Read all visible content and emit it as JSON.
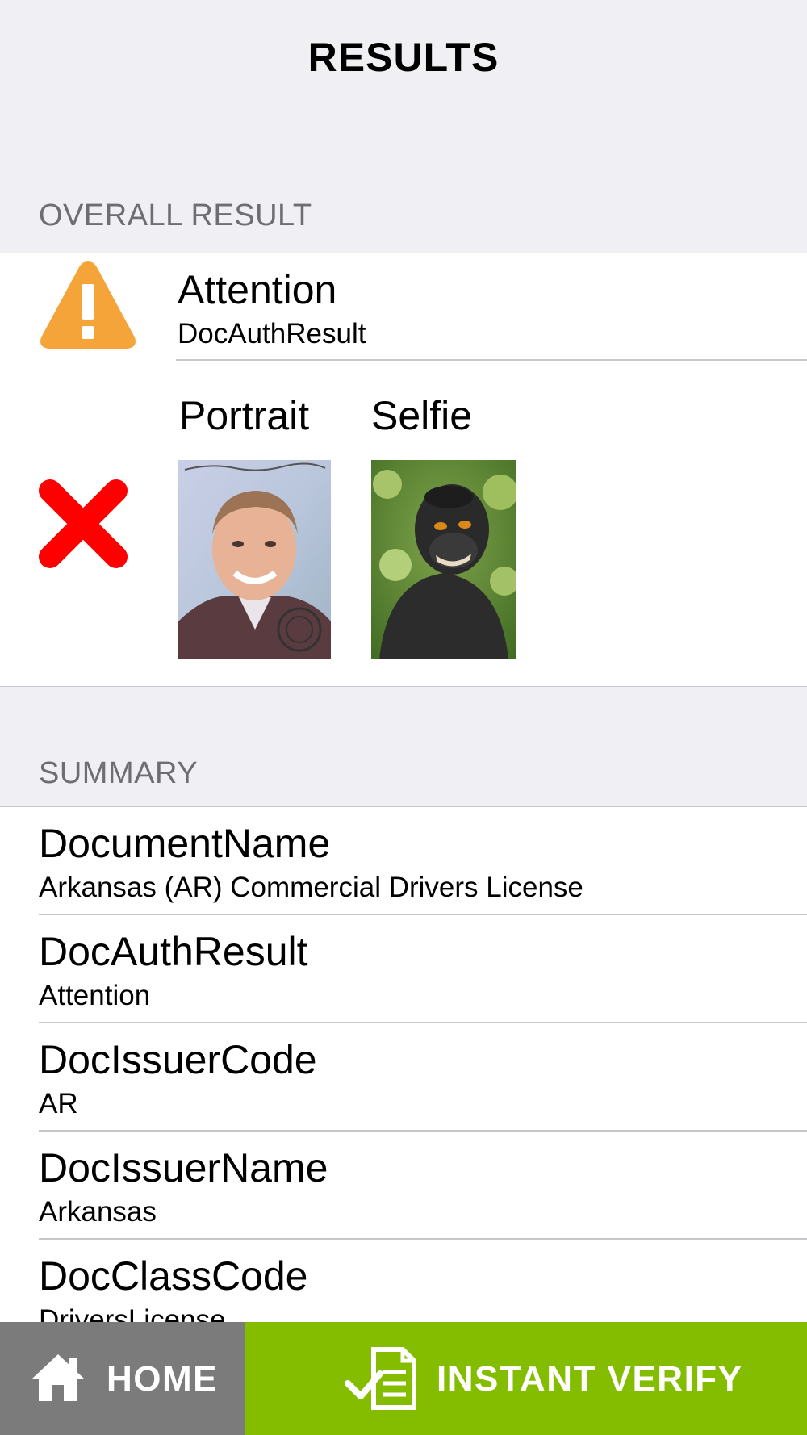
{
  "header": {
    "title": "RESULTS"
  },
  "overall": {
    "section_label": "OVERALL RESULT",
    "result_title": "Attention",
    "result_subtitle": "DocAuthResult",
    "status_icon": "warning-icon",
    "status_color": "#f5a43a",
    "face_match": {
      "status_icon": "fail-x-icon",
      "status_color": "#ff0000",
      "portrait_label": "Portrait",
      "selfie_label": "Selfie"
    }
  },
  "summary": {
    "section_label": "SUMMARY",
    "rows": [
      {
        "key": "DocumentName",
        "value": "Arkansas (AR) Commercial Drivers License"
      },
      {
        "key": "DocAuthResult",
        "value": "Attention"
      },
      {
        "key": "DocIssuerCode",
        "value": "AR"
      },
      {
        "key": "DocIssuerName",
        "value": "Arkansas"
      },
      {
        "key": "DocClassCode",
        "value": "DriversLicense"
      }
    ]
  },
  "bottom_bar": {
    "home_label": "HOME",
    "home_icon": "house-icon",
    "home_color": "#7b7b7b",
    "verify_label": "INSTANT VERIFY",
    "verify_icon": "document-check-icon",
    "verify_color": "#84bd00"
  }
}
